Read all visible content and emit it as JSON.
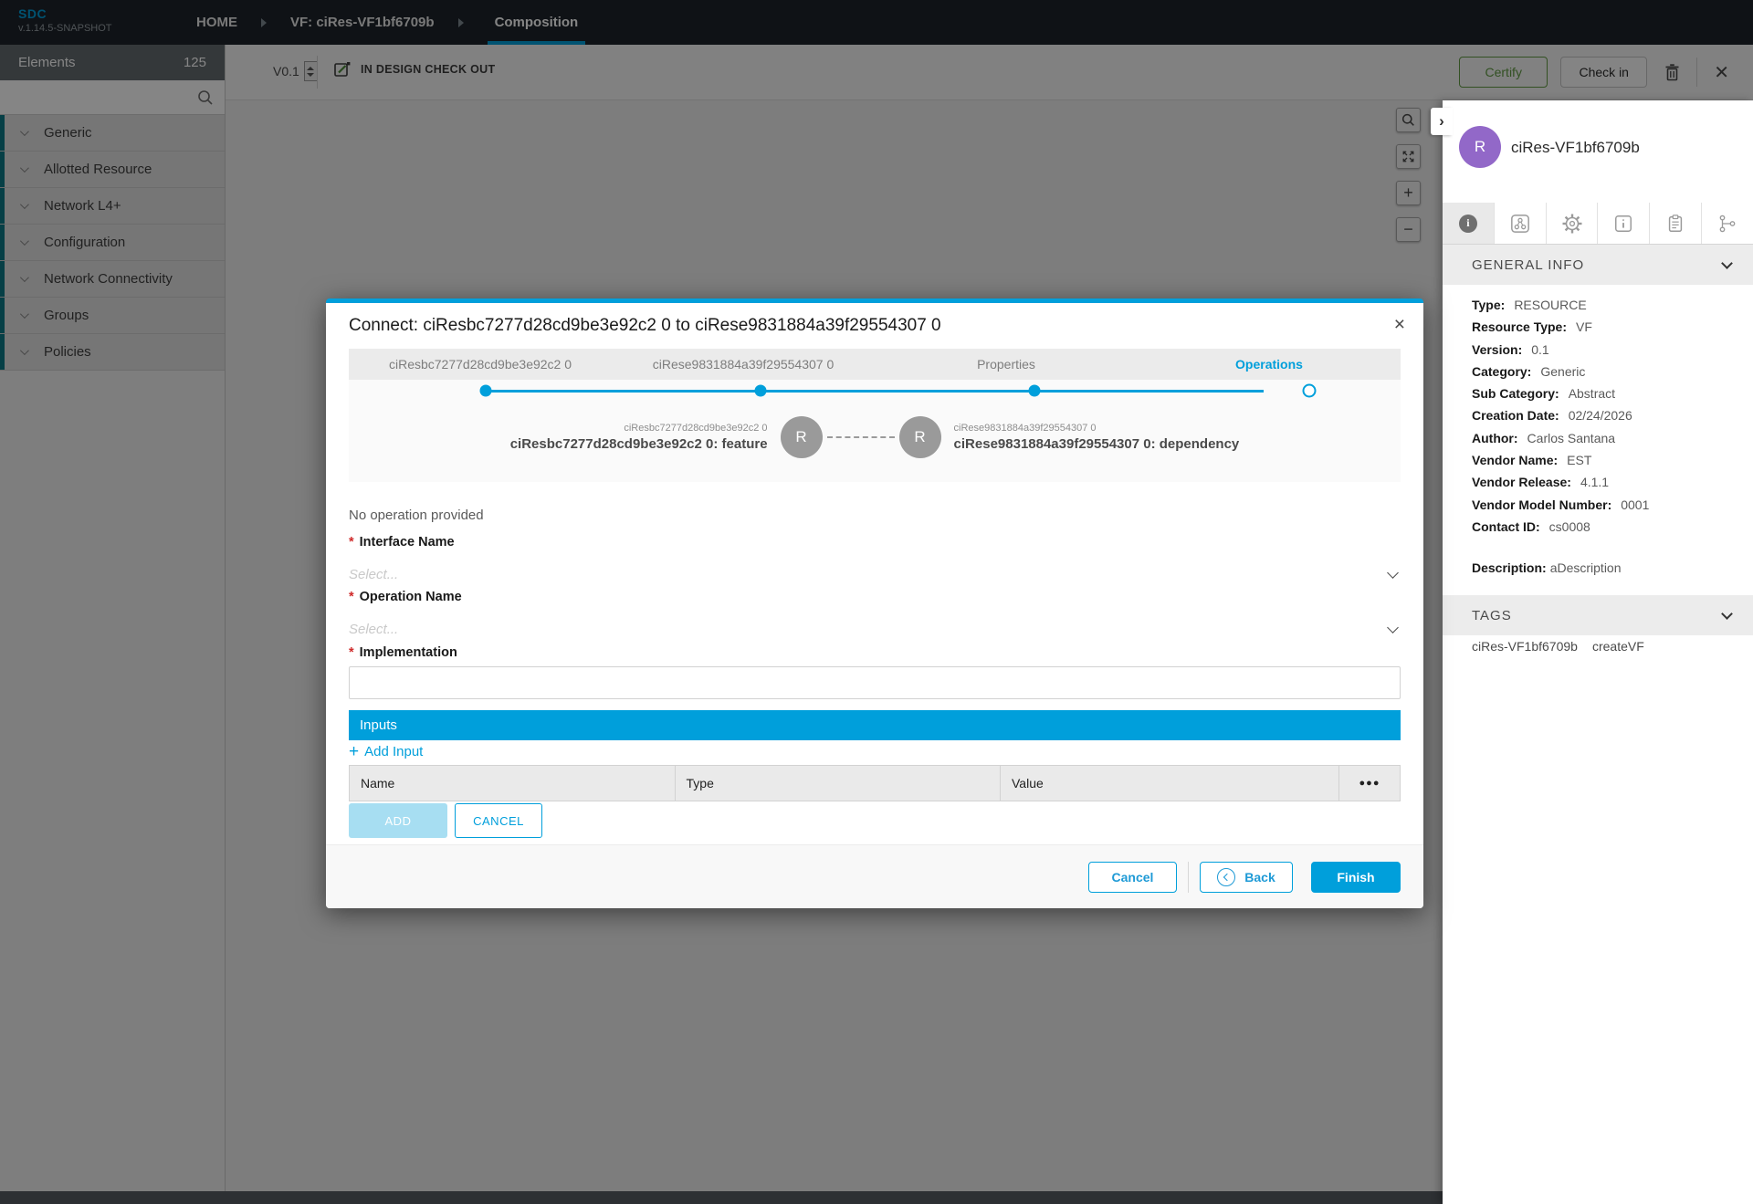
{
  "app": {
    "logo": "SDC",
    "version": "v.1.14.5-SNAPSHOT"
  },
  "breadcrumbs": {
    "home": "HOME",
    "vf": "VF: ciRes-VF1bf6709b",
    "composition": "Composition"
  },
  "toolbar": {
    "version": "V0.1",
    "status": "IN DESIGN CHECK OUT",
    "certify_label": "Certify",
    "checkin_label": "Check in"
  },
  "sidebar": {
    "title": "Elements",
    "count": "125",
    "items": [
      {
        "label": "Generic"
      },
      {
        "label": "Allotted Resource"
      },
      {
        "label": "Network L4+"
      },
      {
        "label": "Configuration"
      },
      {
        "label": "Network Connectivity"
      },
      {
        "label": "Groups"
      },
      {
        "label": "Policies"
      }
    ]
  },
  "canvas": {
    "zoom_in": "+",
    "zoom_out": "−"
  },
  "panel": {
    "collapse_glyph": "›",
    "avatar_letter": "R",
    "title": "ciRes-VF1bf6709b",
    "general_info": {
      "title": "GENERAL INFO",
      "fields": [
        {
          "label": "Type:",
          "value": "RESOURCE"
        },
        {
          "label": "Resource Type:",
          "value": "VF"
        },
        {
          "label": "Version:",
          "value": "0.1"
        },
        {
          "label": "Category:",
          "value": "Generic"
        },
        {
          "label": "Sub Category:",
          "value": "Abstract"
        },
        {
          "label": "Creation Date:",
          "value": "02/24/2026"
        },
        {
          "label": "Author:",
          "value": "Carlos Santana"
        },
        {
          "label": "Vendor Name:",
          "value": "EST"
        },
        {
          "label": "Vendor Release:",
          "value": "4.1.1"
        },
        {
          "label": "Vendor Model Number:",
          "value": "0001"
        },
        {
          "label": "Contact ID:",
          "value": "cs0008"
        }
      ],
      "description_label": "Description:",
      "description_value": "aDescription"
    },
    "tags": {
      "title": "TAGS",
      "items": [
        {
          "label": "ciRes-VF1bf6709b"
        },
        {
          "label": "createVF"
        }
      ]
    }
  },
  "modal": {
    "title": "Connect: ciResbc7277d28cd9be3e92c2 0 to ciRese9831884a39f29554307 0",
    "close_glyph": "×",
    "steps": [
      {
        "label": "ciResbc7277d28cd9be3e92c2 0"
      },
      {
        "label": "ciRese9831884a39f29554307 0"
      },
      {
        "label": "Properties"
      },
      {
        "label": "Operations"
      }
    ],
    "diagram": {
      "left_small": "ciResbc7277d28cd9be3e92c2 0",
      "left_big": "ciResbc7277d28cd9be3e92c2 0: feature",
      "left_letter": "R",
      "right_letter": "R",
      "right_small": "ciRese9831884a39f29554307 0",
      "right_big": "ciRese9831884a39f29554307 0: dependency"
    },
    "no_operation": "No operation provided",
    "fields": {
      "required_mark": "*",
      "interface_label": "Interface Name",
      "operation_label": "Operation Name",
      "implementation_label": "Implementation",
      "select_placeholder": "Select..."
    },
    "inputs": {
      "header": "Inputs",
      "add_icon": "+",
      "add_label": "Add Input",
      "col_name": "Name",
      "col_type": "Type",
      "col_value": "Value",
      "menu_dots": "●●●",
      "add_btn": "ADD",
      "cancel_btn": "CANCEL"
    },
    "footer": {
      "cancel": "Cancel",
      "back": "Back",
      "finish": "Finish"
    }
  },
  "colors": {
    "accent": "#009fdb",
    "avatar": "#9268c8",
    "certify_green": "#629c44",
    "required_red": "#cf2a2a"
  }
}
